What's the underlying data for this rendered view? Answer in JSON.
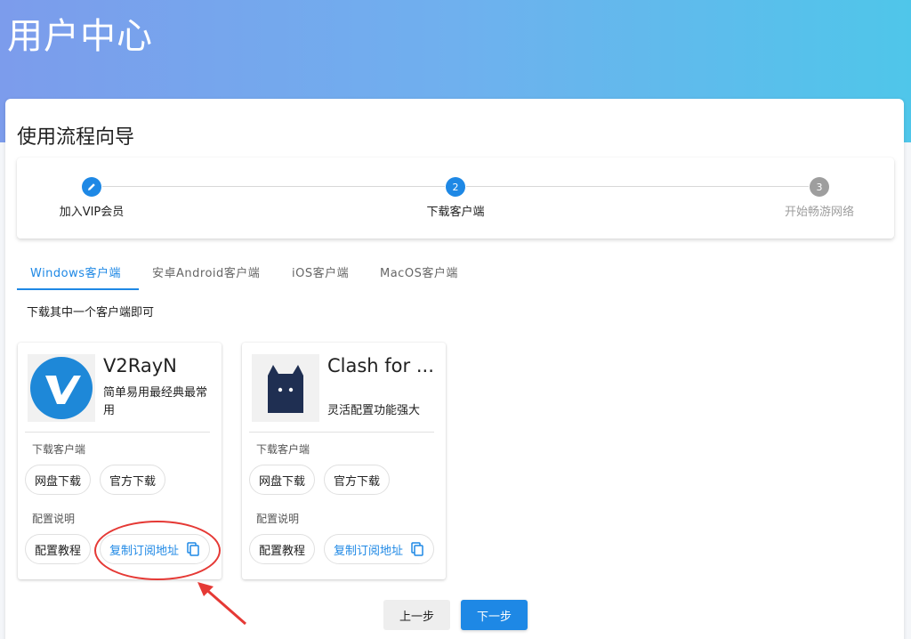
{
  "header": {
    "title": "用户中心"
  },
  "guide": {
    "title": "使用流程向导",
    "steps": [
      {
        "label": "加入VIP会员",
        "state": "done",
        "icon": "pencil-icon"
      },
      {
        "number": "2",
        "label": "下载客户端",
        "state": "active"
      },
      {
        "number": "3",
        "label": "开始畅游网络",
        "state": "pending"
      }
    ]
  },
  "tabs": [
    {
      "label": "Windows客户端",
      "active": true
    },
    {
      "label": "安卓Android客户端"
    },
    {
      "label": "iOS客户端"
    },
    {
      "label": "MacOS客户端"
    }
  ],
  "hint": "下载其中一个客户端即可",
  "clients": [
    {
      "name": "V2RayN",
      "description": "简单易用最经典最常用",
      "logo": "v2rayn-logo",
      "download_label": "下载客户端",
      "download_buttons": [
        "网盘下载",
        "官方下载"
      ],
      "config_label": "配置说明",
      "config_buttons": [
        "配置教程",
        "复制订阅地址"
      ]
    },
    {
      "name": "Clash for ...",
      "description": "灵活配置功能强大",
      "logo": "clash-cat-logo",
      "download_label": "下载客户端",
      "download_buttons": [
        "网盘下载",
        "官方下载"
      ],
      "config_label": "配置说明",
      "config_buttons": [
        "配置教程",
        "复制订阅地址"
      ]
    }
  ],
  "navigation": {
    "prev": "上一步",
    "next": "下一步"
  },
  "colors": {
    "accent": "#1e88e5",
    "annotation": "#e53935",
    "done_step": "#1e88e5",
    "pending_step": "#9e9e9e"
  }
}
